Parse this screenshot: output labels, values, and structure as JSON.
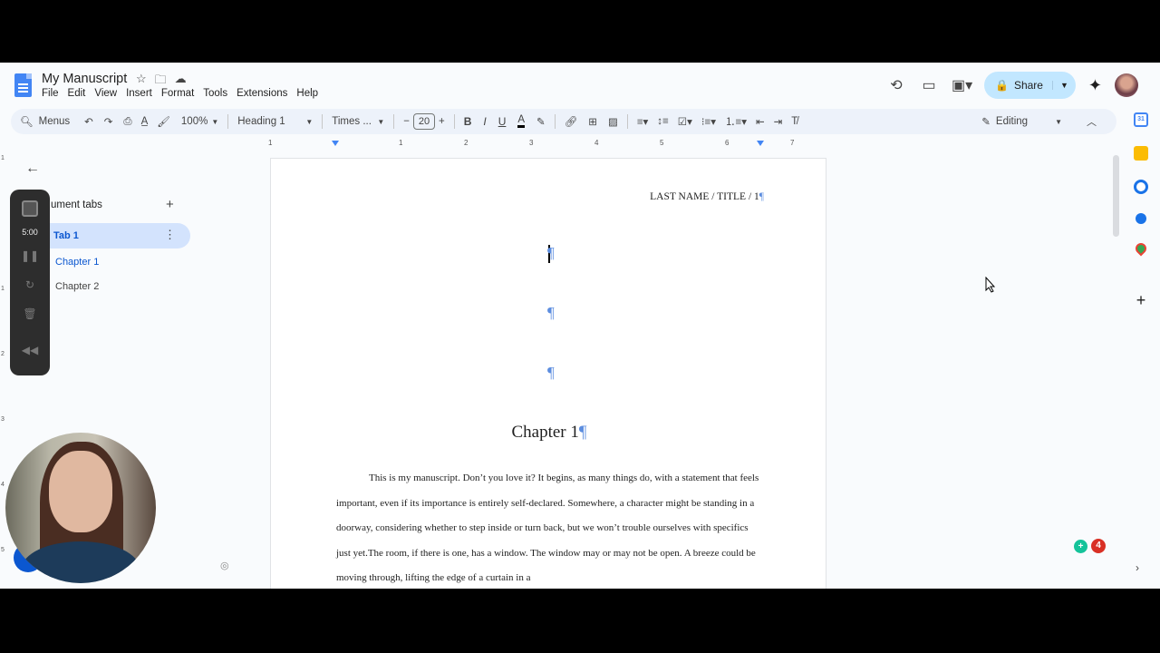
{
  "doc": {
    "title": "My Manuscript",
    "menus": [
      "File",
      "Edit",
      "View",
      "Insert",
      "Format",
      "Tools",
      "Extensions",
      "Help"
    ]
  },
  "header_actions": {
    "share_label": "Share"
  },
  "toolbar": {
    "menus_label": "Menus",
    "zoom": "100%",
    "style": "Heading 1",
    "font": "Times ...",
    "font_size": "20",
    "mode": "Editing"
  },
  "ruler": {
    "numbers": [
      "1",
      "1",
      "2",
      "3",
      "4",
      "5",
      "6",
      "7"
    ]
  },
  "vruler": {
    "numbers": [
      "1",
      "1",
      "2",
      "3",
      "4",
      "5"
    ]
  },
  "sidebar": {
    "heading": "ument tabs",
    "tab_label": "Tab 1",
    "headings": [
      "Chapter 1",
      "Chapter 2"
    ]
  },
  "recorder": {
    "time": "5:00"
  },
  "document": {
    "header": "LAST NAME / TITLE / 1",
    "pilcrow": "¶",
    "chapter_title": "Chapter 1",
    "body": "This is my manuscript. Don’t you love it? It begins, as many things do, with a statement that feels important, even if its importance is entirely self-declared. Somewhere, a character might be standing in a doorway, considering whether to step inside or turn back, but we won’t trouble ourselves with specifics just yet.The room, if there is one, has a window. The window may or may not be open. A breeze could be moving through, lifting the edge of a curtain in a"
  },
  "notifications": {
    "count": "4"
  },
  "colors": {
    "accent": "#0b57d0",
    "share_bg": "#c2e7ff",
    "pilcrow": "#5c8ddf"
  }
}
